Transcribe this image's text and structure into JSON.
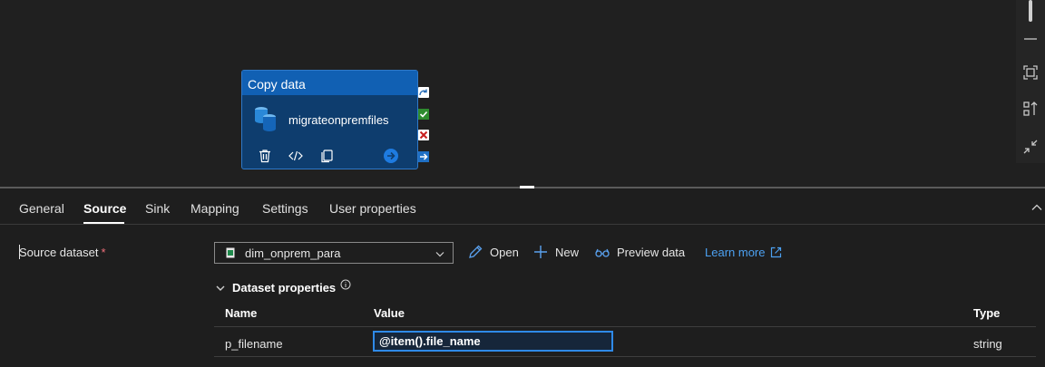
{
  "activity": {
    "type_label": "Copy data",
    "name": "migrateonpremfiles",
    "icons": [
      "delete-icon",
      "code-icon",
      "clone-icon",
      "go-icon"
    ],
    "handles": [
      "skip-handle-icon",
      "success-handle-icon",
      "fail-handle-icon",
      "complete-handle-icon"
    ]
  },
  "canvas_toolbar": {
    "icons": [
      "zoom-out-icon",
      "fit-to-window-icon",
      "auto-align-icon",
      "collapse-arrows-icon"
    ]
  },
  "tabs": [
    "General",
    "Source",
    "Sink",
    "Mapping",
    "Settings",
    "User properties"
  ],
  "active_tab": "Source",
  "source": {
    "label": "Source dataset",
    "required_mark": "*",
    "dataset_value": "dim_onprem_para",
    "open_label": "Open",
    "new_label": "New",
    "preview_label": "Preview data",
    "learn_more_label": "Learn more"
  },
  "dataset_properties": {
    "title": "Dataset properties",
    "columns": {
      "name": "Name",
      "value": "Value",
      "type": "Type"
    },
    "rows": [
      {
        "name": "p_filename",
        "value": "@item().file_name",
        "type": "string"
      }
    ]
  },
  "colors": {
    "accent": "#1160b3",
    "link": "#4ca0f0",
    "success": "#2e8b2e",
    "failure": "#c81e1e"
  }
}
